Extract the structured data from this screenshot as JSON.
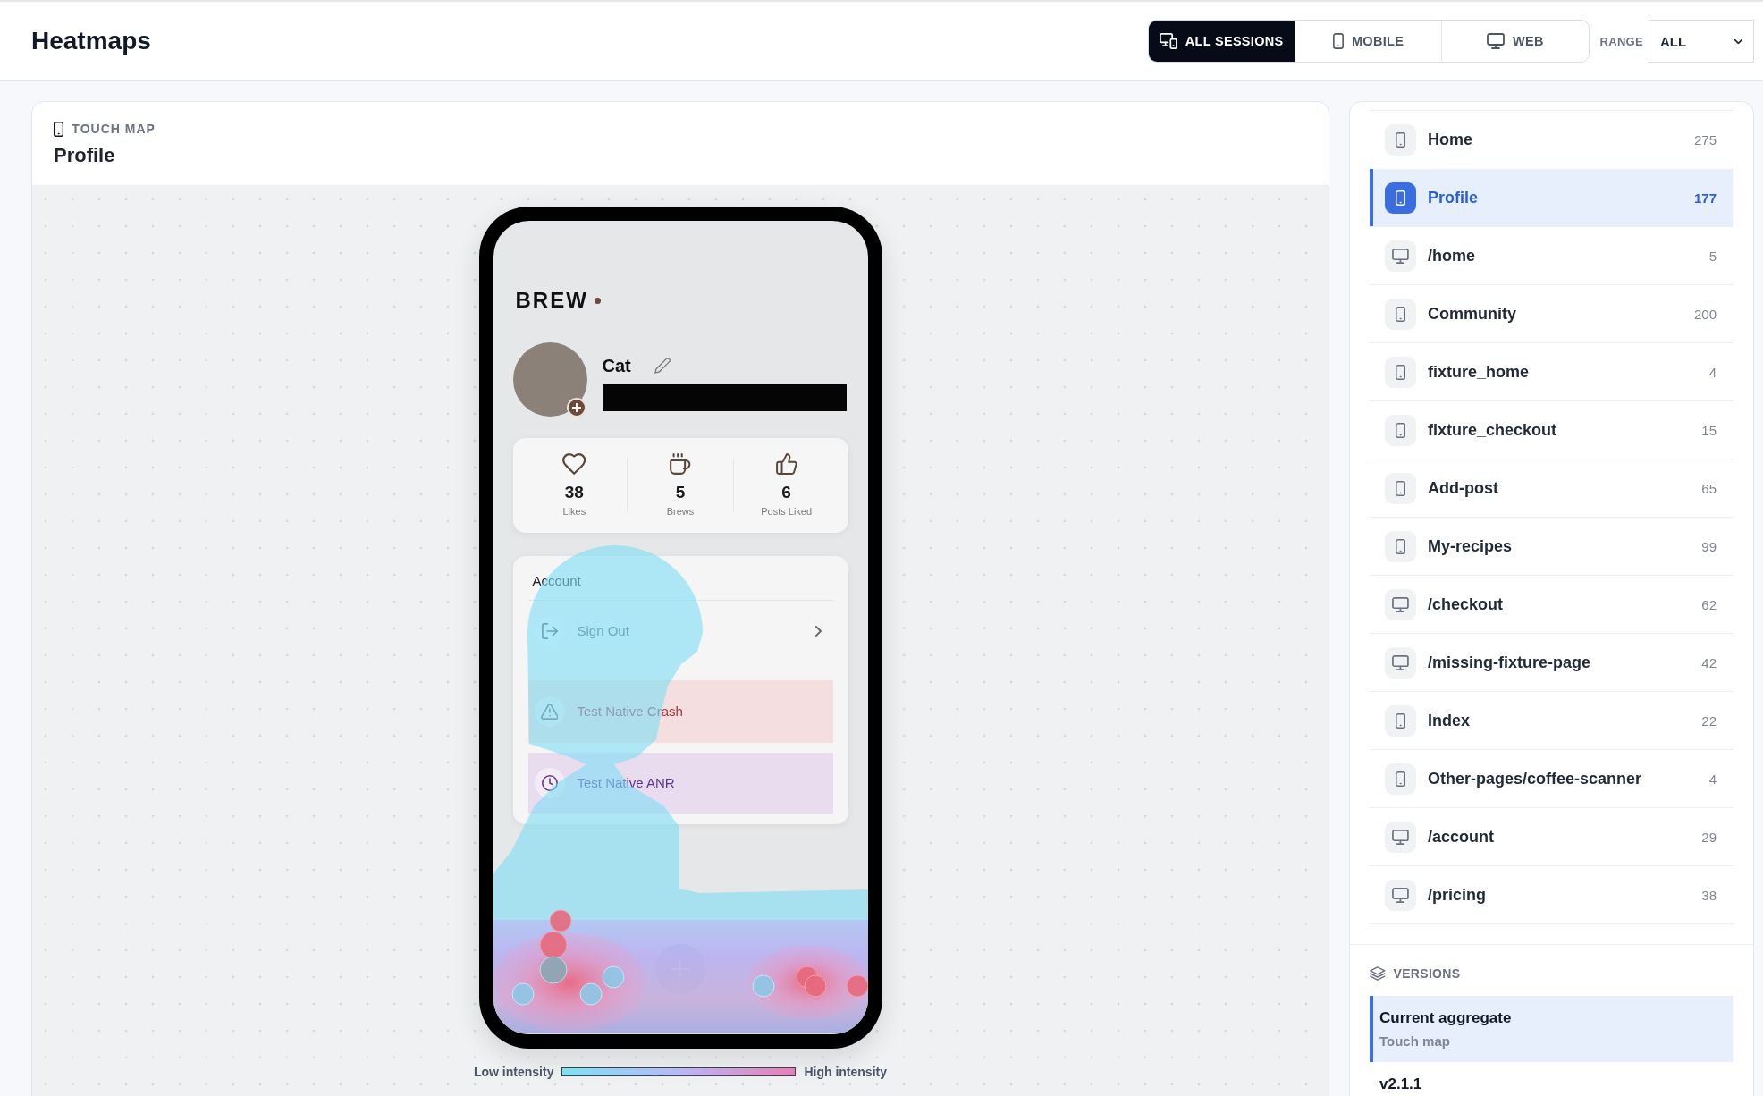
{
  "header": {
    "title": "Heatmaps",
    "platform_tabs": [
      {
        "label": "ALL SESSIONS",
        "kind": "all",
        "selected": true
      },
      {
        "label": "MOBILE",
        "kind": "mobile",
        "selected": false
      },
      {
        "label": "WEB",
        "kind": "web",
        "selected": false
      }
    ],
    "range": {
      "label": "RANGE",
      "value": "ALL"
    }
  },
  "map_panel": {
    "kind_label": "TOUCH MAP",
    "title": "Profile",
    "phone": {
      "brand": "BREW",
      "user_name": "Cat",
      "stats": [
        {
          "kind": "likes",
          "value": "38",
          "label": "Likes"
        },
        {
          "kind": "brews",
          "value": "5",
          "label": "Brews"
        },
        {
          "kind": "liked",
          "value": "6",
          "label": "Posts Liked"
        }
      ],
      "account": {
        "heading": "Account",
        "items": [
          {
            "kind": "signout",
            "label": "Sign Out"
          },
          {
            "kind": "crash",
            "label": "Test Native Crash"
          },
          {
            "kind": "anr",
            "label": "Test Native ANR"
          }
        ]
      }
    },
    "legend": {
      "low": "Low intensity",
      "high": "High intensity"
    }
  },
  "pages": [
    {
      "name": "Home",
      "kind": "mobile",
      "count": "275",
      "selected": false
    },
    {
      "name": "Profile",
      "kind": "mobile",
      "count": "177",
      "selected": true
    },
    {
      "name": "/home",
      "kind": "web",
      "count": "5",
      "selected": false
    },
    {
      "name": "Community",
      "kind": "mobile",
      "count": "200",
      "selected": false
    },
    {
      "name": "fixture_home",
      "kind": "mobile",
      "count": "4",
      "selected": false
    },
    {
      "name": "fixture_checkout",
      "kind": "mobile",
      "count": "15",
      "selected": false
    },
    {
      "name": "Add-post",
      "kind": "mobile",
      "count": "65",
      "selected": false
    },
    {
      "name": "My-recipes",
      "kind": "mobile",
      "count": "99",
      "selected": false
    },
    {
      "name": "/checkout",
      "kind": "web",
      "count": "62",
      "selected": false
    },
    {
      "name": "/missing-fixture-page",
      "kind": "web",
      "count": "42",
      "selected": false
    },
    {
      "name": "Index",
      "kind": "mobile",
      "count": "22",
      "selected": false
    },
    {
      "name": "Other-pages/coffee-scanner",
      "kind": "mobile",
      "count": "4",
      "selected": false
    },
    {
      "name": "/account",
      "kind": "web",
      "count": "29",
      "selected": false
    },
    {
      "name": "/pricing",
      "kind": "web",
      "count": "38",
      "selected": false
    }
  ],
  "versions": {
    "heading": "VERSIONS",
    "items": [
      {
        "title": "Current aggregate",
        "subtitle": "Touch map",
        "selected": true
      },
      {
        "title": "v2.1.1",
        "selected": false
      }
    ]
  }
}
